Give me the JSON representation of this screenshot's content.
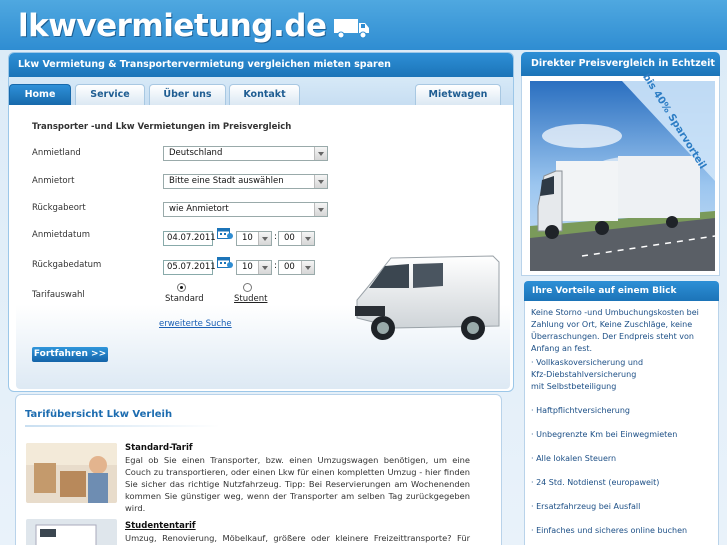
{
  "header": {
    "logo_text": "lkwvermietung.de",
    "truck_icon": "truck-icon"
  },
  "main": {
    "headline": "Lkw Vermietung & Transportervermietung vergleichen mieten sparen",
    "tabs": [
      {
        "label": "Home",
        "active": true
      },
      {
        "label": "Service",
        "active": false
      },
      {
        "label": "Über uns",
        "active": false
      },
      {
        "label": "Kontakt",
        "active": false
      },
      {
        "label": "Mietwagen",
        "active": false
      }
    ],
    "form": {
      "title": "Transporter -und Lkw Vermietungen im Preisvergleich",
      "land_label": "Anmietland",
      "land_value": "Deutschland",
      "ort_label": "Anmietort",
      "ort_value": "Bitte eine Stadt auswählen",
      "rueck_label": "Rückgabeort",
      "rueck_value": "wie Anmietort",
      "datum_label": "Anmietdatum",
      "datum_value": "04.07.2011",
      "datum_hour": "10",
      "datum_min": "00",
      "rdatum_label": "Rückgabedatum",
      "rdatum_value": "05.07.2011",
      "rdatum_hour": "10",
      "rdatum_min": "00",
      "tarif_label": "Tarifauswahl",
      "tarif_standard": "Standard",
      "tarif_student": "Student",
      "extended_search": "erweiterte Suche",
      "submit": "Fortfahren >>",
      "colon": ":"
    }
  },
  "tarif": {
    "heading": "Tarifübersicht Lkw Verleih",
    "items": [
      {
        "title": "Standard-Tarif",
        "body": "Egal ob Sie einen Transporter, bzw. einen Umzugswagen benötigen, um eine Couch zu transportieren, oder einen Lkw für einen kompletten Umzug - hier finden Sie sicher das richtige Nutzfahrzeug. Tipp: Bei Reservierungen am Wochenenden kommen Sie günstiger weg, wenn der Transporter am selben Tag zurückgegeben wird."
      },
      {
        "title": "Studententarif",
        "body": "Umzug, Renovierung, Möbelkauf, größere oder kleinere Freizeittransporte? Für Studenten ab"
      }
    ]
  },
  "right": {
    "headline": "Direkter Preisvergleich in Echtzeit",
    "banner": "bis 40% Sparvorteil",
    "adv_heading": "Ihre Vorteile auf einem Blick",
    "adv_intro": "Keine Storno -und Umbuchungskosten bei Zahlung vor Ort, Keine Zuschläge, keine Überraschungen. Der Endpreis steht von Anfang an fest.",
    "adv_items": [
      "· Vollkaskoversicherung und\n  Kfz-Diebstahlversicherung\n  mit Selbstbeteiligung",
      "· Haftpflichtversicherung",
      "· Unbegrenzte Km bei Einwegmieten",
      "· Alle lokalen Steuern",
      "· 24 Std. Notdienst (europaweit)",
      "· Ersatzfahrzeug bei Ausfall",
      "· Einfaches und sicheres online buchen"
    ]
  },
  "colors": {
    "brand_blue": "#1c74b8",
    "link_blue": "#1a5fb4"
  }
}
